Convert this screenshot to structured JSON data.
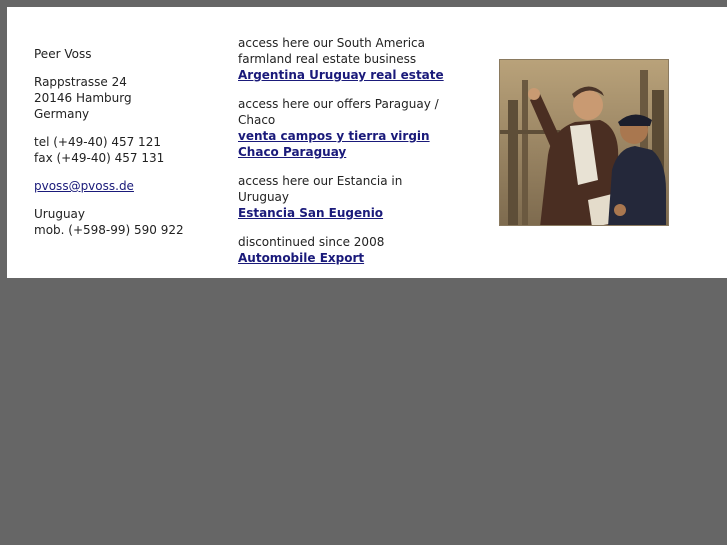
{
  "contact": {
    "name": "Peer Voss",
    "street": "Rappstrasse 24",
    "city": "20146 Hamburg",
    "country": "Germany",
    "tel": "tel (+49-40) 457 121",
    "fax": "fax (+49-40) 457 131",
    "email": "pvoss@pvoss.de",
    "region2": "Uruguay",
    "mobile": "mob. (+598-99) 590 922"
  },
  "offers": [
    {
      "intro": "access here our South America farmland real estate business",
      "link": "Argentina Uruguay real estate"
    },
    {
      "intro": "access here our offers Paraguay / Chaco",
      "link": "venta campos y tierra virgin Chaco Paraguay"
    },
    {
      "intro": "access here our Estancia in Uruguay",
      "link": "Estancia San Eugenio"
    },
    {
      "intro": "discontinued since 2008",
      "link": "Automobile Export"
    }
  ],
  "colors": {
    "page_background": "#666666",
    "panel_background": "#ffffff",
    "link": "#1a1a7a",
    "text": "#222222"
  },
  "image": {
    "icon": "painting-two-men-icon"
  }
}
